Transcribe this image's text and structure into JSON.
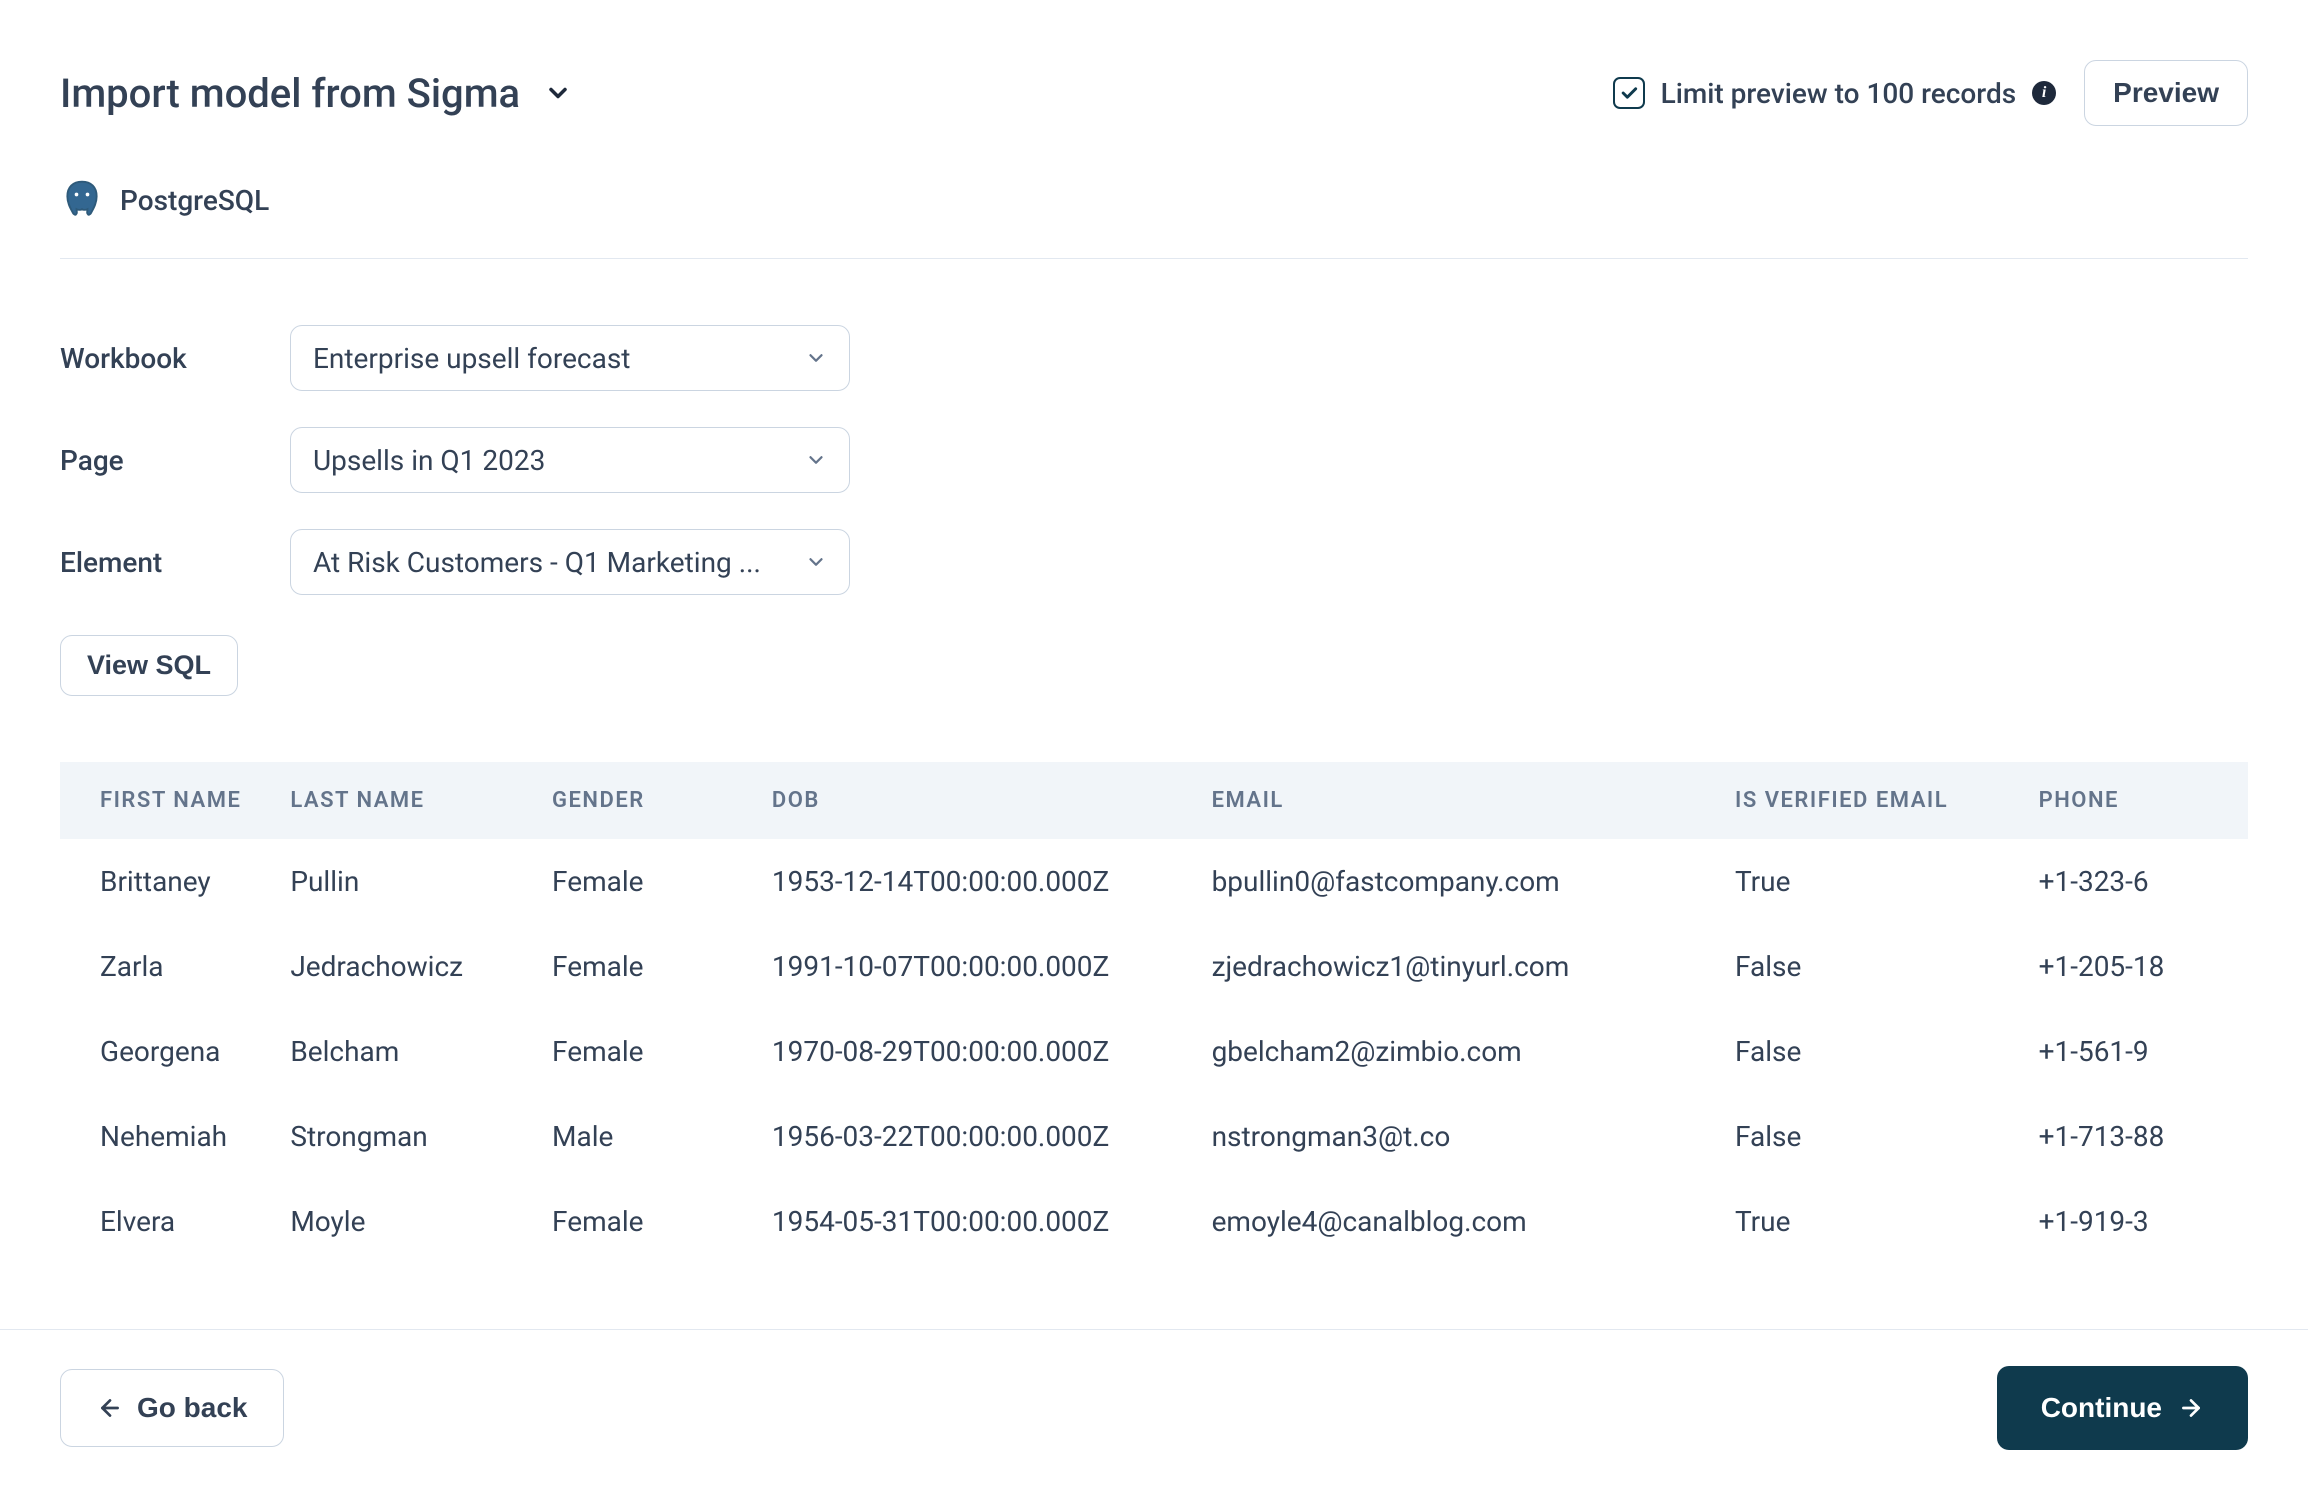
{
  "header": {
    "title": "Import model from Sigma",
    "limit_label": "Limit preview to 100 records",
    "limit_checked": true,
    "preview_button": "Preview"
  },
  "source": {
    "name": "PostgreSQL"
  },
  "form": {
    "workbook_label": "Workbook",
    "page_label": "Page",
    "element_label": "Element",
    "workbook_value": "Enterprise upsell forecast",
    "page_value": "Upsells in Q1 2023",
    "element_value": "At Risk Customers - Q1 Marketing ...",
    "view_sql_label": "View SQL"
  },
  "table": {
    "columns": [
      "FIRST NAME",
      "LAST NAME",
      "GENDER",
      "DOB",
      "EMAIL",
      "IS VERIFIED EMAIL",
      "PHONE"
    ],
    "rows": [
      {
        "first_name": "Brittaney",
        "last_name": "Pullin",
        "gender": "Female",
        "dob": "1953-12-14T00:00:00.000Z",
        "email": "bpullin0@fastcompany.com",
        "is_verified": "True",
        "phone": "+1-323-6"
      },
      {
        "first_name": "Zarla",
        "last_name": "Jedrachowicz",
        "gender": "Female",
        "dob": "1991-10-07T00:00:00.000Z",
        "email": "zjedrachowicz1@tinyurl.com",
        "is_verified": "False",
        "phone": "+1-205-18"
      },
      {
        "first_name": "Georgena",
        "last_name": "Belcham",
        "gender": "Female",
        "dob": "1970-08-29T00:00:00.000Z",
        "email": "gbelcham2@zimbio.com",
        "is_verified": "False",
        "phone": "+1-561-9"
      },
      {
        "first_name": "Nehemiah",
        "last_name": "Strongman",
        "gender": "Male",
        "dob": "1956-03-22T00:00:00.000Z",
        "email": "nstrongman3@t.co",
        "is_verified": "False",
        "phone": "+1-713-88"
      },
      {
        "first_name": "Elvera",
        "last_name": "Moyle",
        "gender": "Female",
        "dob": "1954-05-31T00:00:00.000Z",
        "email": "emoyle4@canalblog.com",
        "is_verified": "True",
        "phone": "+1-919-3"
      }
    ]
  },
  "footer": {
    "back_label": "Go back",
    "continue_label": "Continue"
  }
}
